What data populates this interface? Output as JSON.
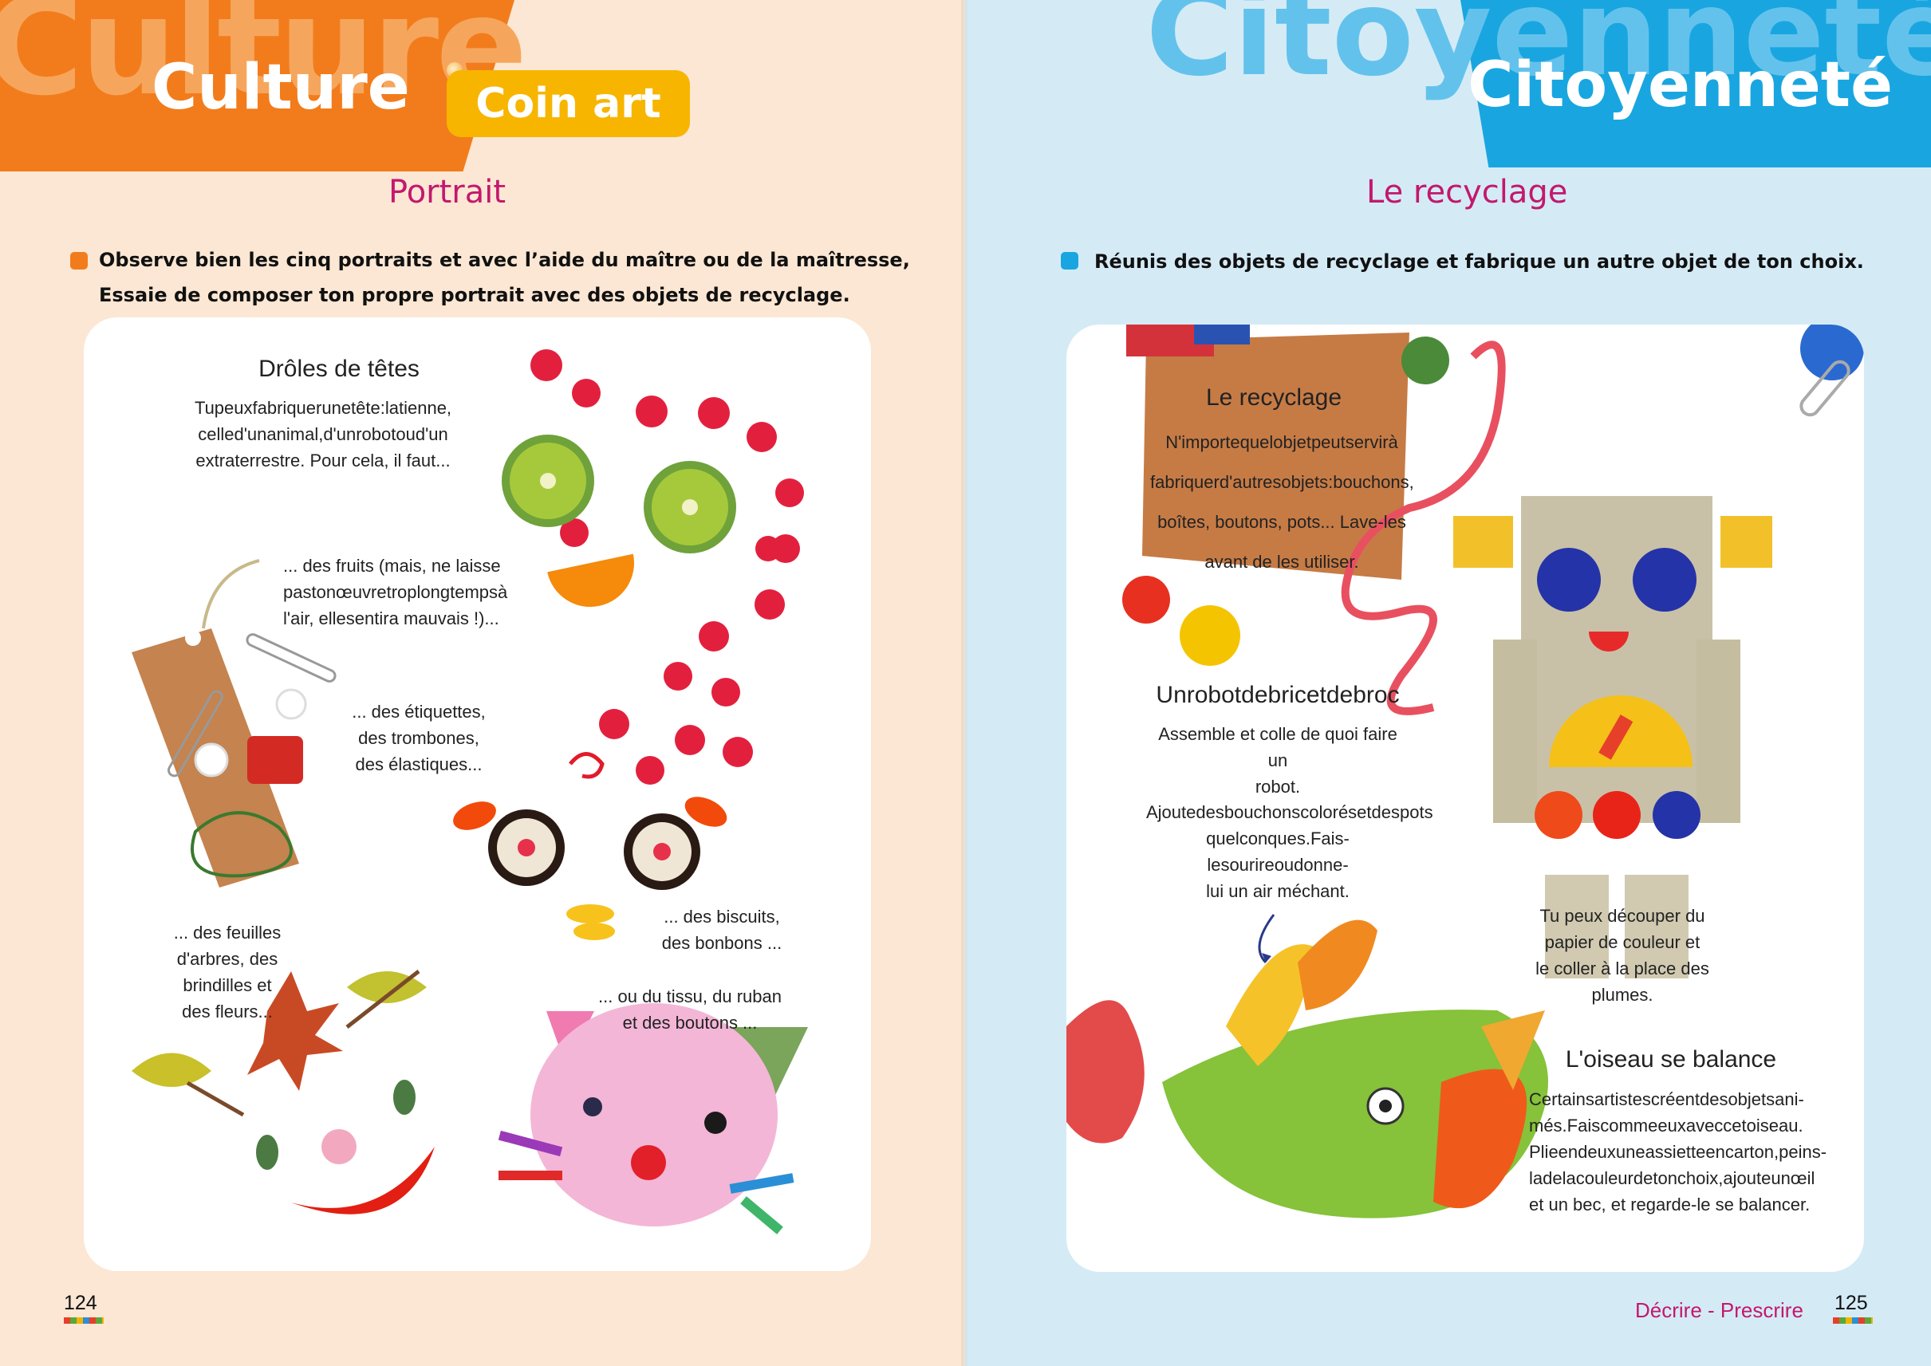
{
  "left": {
    "header": {
      "ghost": "Culture",
      "title": "Culture",
      "badge": "Coin art"
    },
    "section_title": "Portrait",
    "instruction": {
      "line1": "Observe bien les cinq portraits et avec l’aide du maître ou de la maîtresse,",
      "line2": "Essaie de composer ton propre portrait avec des objets de recyclage."
    },
    "panel": {
      "title": "Drôles de têtes",
      "intro": [
        "Tupeuxfabriquerunetête:latienne,",
        "celled'unanimal,d'unrobotoud'un",
        "extraterrestre. Pour cela, il faut..."
      ],
      "fruits": [
        "... des fruits (mais, ne laisse",
        "pastonœuvretroplongtempsà",
        "l'air, ellesentira mauvais !)..."
      ],
      "tags": [
        "... des étiquettes,",
        "des trombones,",
        "des élastiques..."
      ],
      "biscuits": [
        "... des biscuits,",
        "des bonbons ..."
      ],
      "leaves": [
        "... des feuilles",
        "d'arbres, des",
        "brindilles et",
        "des fleurs..."
      ],
      "fabric": [
        "... ou du tissu, du ruban",
        "et des boutons ..."
      ]
    },
    "page_number": "124"
  },
  "right": {
    "header": {
      "ghost": "Citoyenneté",
      "title": "Citoyenneté"
    },
    "section_title": "Le recyclage",
    "instruction": "Réunis des objets de recyclage et fabrique un autre objet de ton choix.",
    "panel": {
      "card_title": "Le recyclage",
      "card_text": [
        "N'importequelobjetpeutservirà",
        "fabriquerd'autresobjets:bouchons,",
        "boîtes, boutons, pots... Lave-les",
        "avant de les utiliser."
      ],
      "robot_title": "Unrobotdebricetdebroc",
      "robot_text1": [
        "Assemble et colle de quoi faire un",
        "robot."
      ],
      "robot_text2": [
        "Ajoutedesbouchonscolorésetdespots",
        "quelconques.Fais-lesourireoudonne-",
        "lui un air méchant."
      ],
      "paper_text": [
        "Tu peux découper du",
        "papier de couleur et",
        "le coller à la place des",
        "plumes."
      ],
      "bird_title": "L'oiseau se balance",
      "bird_text": [
        "Certainsartistescréentdesobjetsani-",
        "més.Faiscommeeuxaveccetoiseau.",
        "Plieendeuxuneassietteencarton,peins-",
        "ladelacouleurdetonchoix,ajouteunœil",
        "et un bec, et regarde-le se balancer."
      ]
    },
    "footer": "Décrire - Prescrire",
    "page_number": "125"
  }
}
